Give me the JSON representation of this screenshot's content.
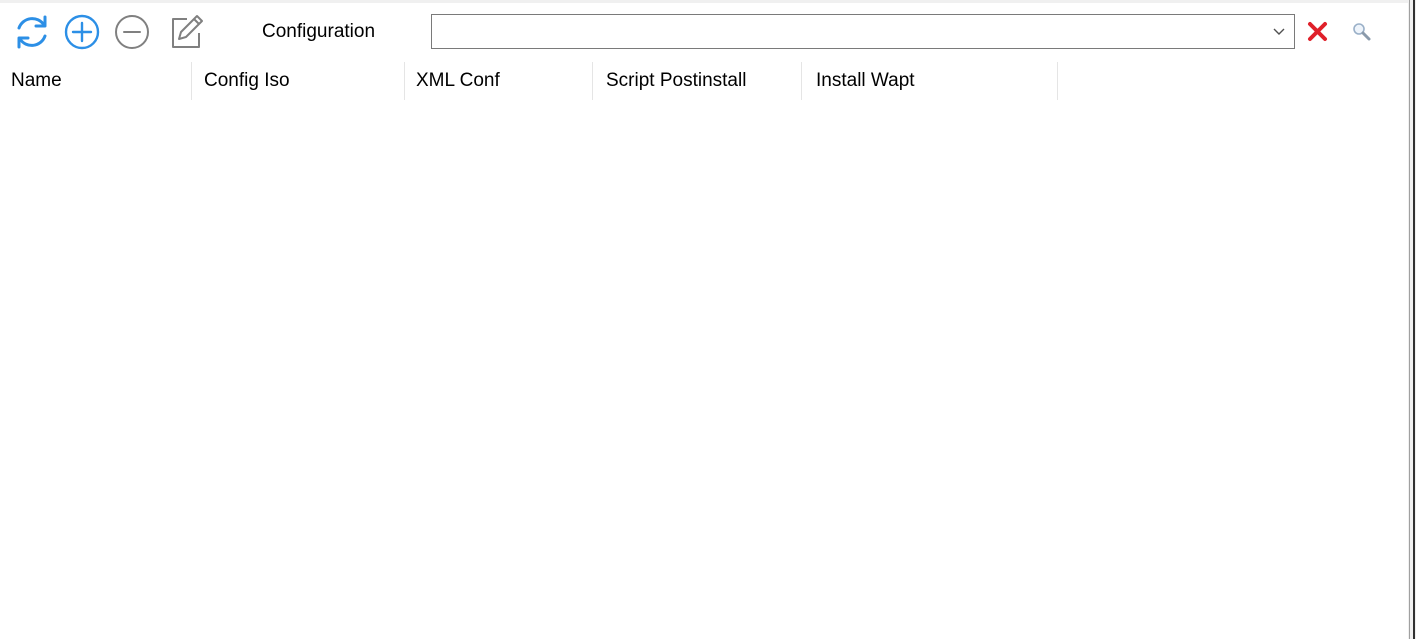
{
  "toolbar": {
    "buttons": [
      {
        "name": "refresh",
        "icon": "refresh-icon",
        "color": "#2c8fe6"
      },
      {
        "name": "add",
        "icon": "plus-circle-icon",
        "color": "#2c8fe6"
      },
      {
        "name": "remove",
        "icon": "minus-circle-icon",
        "color": "#808080"
      },
      {
        "name": "edit",
        "icon": "edit-icon",
        "color": "#808080"
      }
    ],
    "configuration_label": "Configuration",
    "configuration_value": "",
    "clear_icon": "clear-x-icon",
    "clear_color": "#e0202a",
    "search_icon": "magnifier-icon"
  },
  "grid": {
    "columns": [
      "Name",
      "Config Iso",
      "XML Conf",
      "Script Postinstall",
      "Install Wapt"
    ],
    "rows": []
  }
}
